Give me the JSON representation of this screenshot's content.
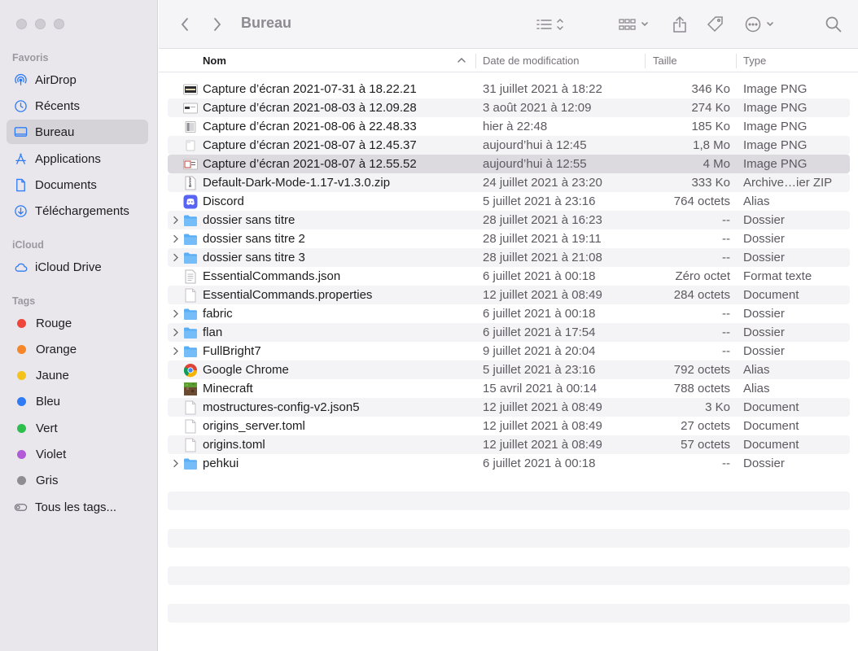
{
  "window": {
    "title": "Bureau"
  },
  "sidebar": {
    "sections": {
      "favorites": "Favoris",
      "icloud": "iCloud",
      "tags": "Tags"
    },
    "favorites": [
      {
        "label": "AirDrop",
        "icon": "airdrop-icon"
      },
      {
        "label": "Récents",
        "icon": "clock-icon"
      },
      {
        "label": "Bureau",
        "icon": "desktop-icon",
        "active": true
      },
      {
        "label": "Applications",
        "icon": "applications-icon"
      },
      {
        "label": "Documents",
        "icon": "document-icon"
      },
      {
        "label": "Téléchargements",
        "icon": "download-icon"
      }
    ],
    "icloud": [
      {
        "label": "iCloud Drive",
        "icon": "cloud-icon"
      }
    ],
    "tags": [
      {
        "label": "Rouge",
        "color": "#f0453a"
      },
      {
        "label": "Orange",
        "color": "#f5862a"
      },
      {
        "label": "Jaune",
        "color": "#f3c31b"
      },
      {
        "label": "Bleu",
        "color": "#2f7cf6"
      },
      {
        "label": "Vert",
        "color": "#2dbe4e"
      },
      {
        "label": "Violet",
        "color": "#b25ad8"
      },
      {
        "label": "Gris",
        "color": "#8e8d92"
      },
      {
        "label": "Tous les tags...",
        "icon": "all-tags-icon"
      }
    ]
  },
  "columns": {
    "name": "Nom",
    "date": "Date de modification",
    "size": "Taille",
    "kind": "Type"
  },
  "files": [
    {
      "name": "Capture d’écran 2021-07-31 à 18.22.21",
      "date": "31 juillet 2021 à 18:22",
      "size": "346 Ko",
      "kind": "Image PNG",
      "icon": "screenshot-dark"
    },
    {
      "name": "Capture d’écran 2021-08-03 à 12.09.28",
      "date": "3 août 2021 à 12:09",
      "size": "274 Ko",
      "kind": "Image PNG",
      "icon": "screenshot-light"
    },
    {
      "name": "Capture d’écran 2021-08-06 à 22.48.33",
      "date": "hier à 22:48",
      "size": "185 Ko",
      "kind": "Image PNG",
      "icon": "screenshot-gray"
    },
    {
      "name": "Capture d’écran 2021-08-07 à 12.45.37",
      "date": "aujourd’hui à 12:45",
      "size": "1,8 Mo",
      "kind": "Image PNG",
      "icon": "screenshot-blank"
    },
    {
      "name": "Capture d’écran 2021-08-07 à 12.55.52",
      "date": "aujourd’hui à 12:55",
      "size": "4 Mo",
      "kind": "Image PNG",
      "icon": "screenshot-red",
      "selected": true
    },
    {
      "name": "Default-Dark-Mode-1.17-v1.3.0.zip",
      "date": "24 juillet 2021 à 23:20",
      "size": "333 Ko",
      "kind": "Archive…ier ZIP",
      "icon": "zip"
    },
    {
      "name": "Discord",
      "date": "5 juillet 2021 à 23:16",
      "size": "764 octets",
      "kind": "Alias",
      "icon": "discord"
    },
    {
      "name": "dossier sans titre",
      "date": "28 juillet 2021 à 16:23",
      "size": "--",
      "kind": "Dossier",
      "icon": "folder",
      "folder": true
    },
    {
      "name": "dossier sans titre 2",
      "date": "28 juillet 2021 à 19:11",
      "size": "--",
      "kind": "Dossier",
      "icon": "folder",
      "folder": true
    },
    {
      "name": "dossier sans titre 3",
      "date": "28 juillet 2021 à 21:08",
      "size": "--",
      "kind": "Dossier",
      "icon": "folder",
      "folder": true
    },
    {
      "name": "EssentialCommands.json",
      "date": "6 juillet 2021 à 00:18",
      "size": "Zéro octet",
      "kind": "Format texte",
      "icon": "text"
    },
    {
      "name": "EssentialCommands.properties",
      "date": "12 juillet 2021 à 08:49",
      "size": "284 octets",
      "kind": "Document",
      "icon": "doc"
    },
    {
      "name": "fabric",
      "date": "6 juillet 2021 à 00:18",
      "size": "--",
      "kind": "Dossier",
      "icon": "folder",
      "folder": true
    },
    {
      "name": "flan",
      "date": "6 juillet 2021 à 17:54",
      "size": "--",
      "kind": "Dossier",
      "icon": "folder",
      "folder": true
    },
    {
      "name": "FullBright7",
      "date": "9 juillet 2021 à 20:04",
      "size": "--",
      "kind": "Dossier",
      "icon": "folder",
      "folder": true
    },
    {
      "name": "Google Chrome",
      "date": "5 juillet 2021 à 23:16",
      "size": "792 octets",
      "kind": "Alias",
      "icon": "chrome"
    },
    {
      "name": "Minecraft",
      "date": "15 avril 2021 à 00:14",
      "size": "788 octets",
      "kind": "Alias",
      "icon": "minecraft"
    },
    {
      "name": "mostructures-config-v2.json5",
      "date": "12 juillet 2021 à 08:49",
      "size": "3 Ko",
      "kind": "Document",
      "icon": "doc"
    },
    {
      "name": "origins_server.toml",
      "date": "12 juillet 2021 à 08:49",
      "size": "27 octets",
      "kind": "Document",
      "icon": "doc"
    },
    {
      "name": "origins.toml",
      "date": "12 juillet 2021 à 08:49",
      "size": "57 octets",
      "kind": "Document",
      "icon": "doc"
    },
    {
      "name": "pehkui",
      "date": "6 juillet 2021 à 00:18",
      "size": "--",
      "kind": "Dossier",
      "icon": "folder",
      "folder": true
    }
  ],
  "accent": "#2f7cf6"
}
